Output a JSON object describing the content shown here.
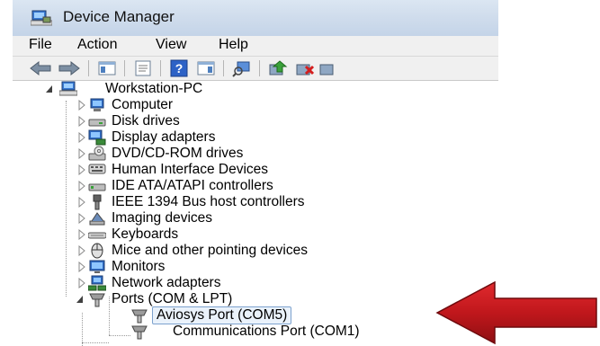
{
  "window": {
    "title": "Device Manager"
  },
  "menu": {
    "file": "File",
    "action": "Action",
    "view": "View",
    "help": "Help"
  },
  "toolbar": {
    "icons": [
      "back-icon",
      "forward-icon",
      "show-hide-console-tree-icon",
      "properties-icon",
      "help-icon",
      "action-pane-icon",
      "scan-for-hardware-changes-icon",
      "update-driver-icon",
      "uninstall-icon",
      "disable-icon"
    ]
  },
  "tree": {
    "root": "Workstation-PC",
    "categories": [
      "Computer",
      "Disk drives",
      "Display adapters",
      "DVD/CD-ROM drives",
      "Human Interface Devices",
      "IDE ATA/ATAPI controllers",
      "IEEE 1394 Bus host controllers",
      "Imaging devices",
      "Keyboards",
      "Mice and other pointing devices",
      "Monitors",
      "Network adapters",
      "Ports (COM & LPT)"
    ],
    "ports": [
      "Aviosys Port (COM5)",
      "Communications Port (COM1)"
    ]
  },
  "colors": {
    "arrow": "#c0171c",
    "selection_border": "#7da2ce",
    "titlebar": "#cfdcec"
  }
}
